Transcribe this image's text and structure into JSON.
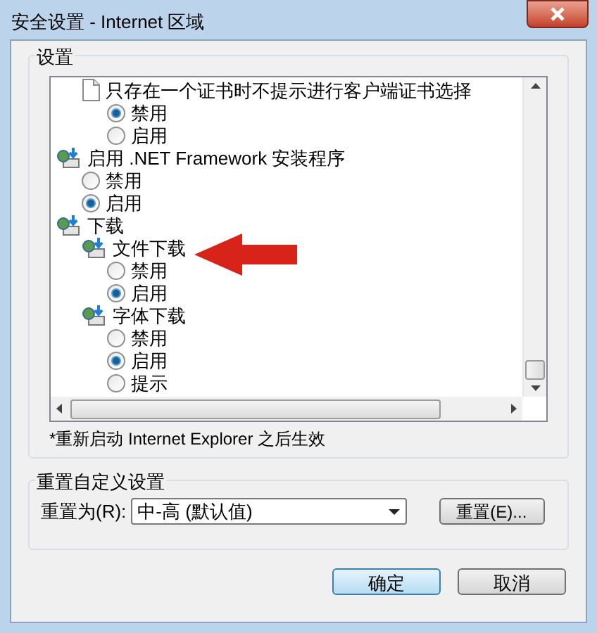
{
  "window": {
    "title": "安全设置 - Internet 区域"
  },
  "settings": {
    "title": "设置",
    "tree": [
      {
        "children": [
          {
            "label": "只存在一个证书时不提示进行客户端证书选择",
            "kind": "page",
            "options": [
              {
                "label": "禁用",
                "selected": true
              },
              {
                "label": "启用",
                "selected": false
              }
            ]
          }
        ]
      },
      {
        "label": "启用 .NET Framework 安装程序",
        "kind": "network",
        "options": [
          {
            "label": "禁用",
            "selected": false
          },
          {
            "label": "启用",
            "selected": true
          }
        ]
      },
      {
        "label": "下载",
        "kind": "network",
        "children": [
          {
            "label": "文件下载",
            "kind": "network",
            "options": [
              {
                "label": "禁用",
                "selected": false
              },
              {
                "label": "启用",
                "selected": true
              }
            ]
          },
          {
            "label": "字体下载",
            "kind": "network",
            "options": [
              {
                "label": "禁用",
                "selected": false
              },
              {
                "label": "启用",
                "selected": true
              },
              {
                "label": "提示",
                "selected": false
              }
            ]
          }
        ]
      }
    ],
    "note": "*重新启动 Internet Explorer 之后生效"
  },
  "reset": {
    "title": "重置自定义设置",
    "label": "重置为(R):",
    "value": "中-高 (默认值)",
    "button": "重置(E)..."
  },
  "buttons": [
    {
      "label": "确定",
      "default": true
    },
    {
      "label": "取消",
      "default": false
    }
  ]
}
